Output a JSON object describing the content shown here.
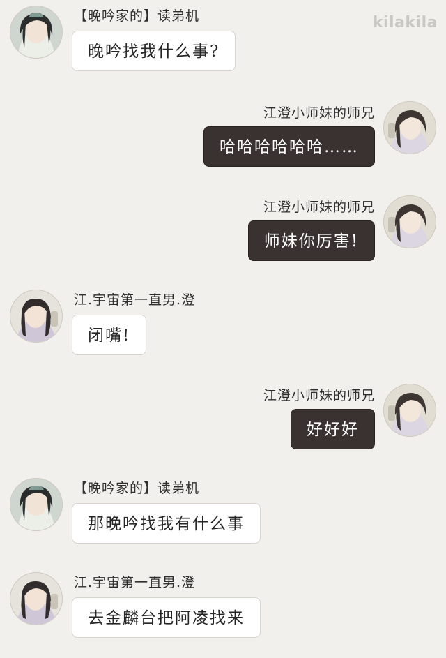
{
  "watermark": "kilakila",
  "messages": [
    {
      "side": "left",
      "avatar": "wanyin-avatar",
      "name": "【晚吟家的】读弟机",
      "text": "晚吟找我什么事?"
    },
    {
      "side": "right",
      "avatar": "senior-brother-avatar",
      "name": "江澄小师妹的师兄",
      "text": "哈哈哈哈哈哈……"
    },
    {
      "side": "right",
      "avatar": "senior-brother-avatar",
      "name": "江澄小师妹的师兄",
      "text": "师妹你厉害!"
    },
    {
      "side": "left",
      "avatar": "jiangcheng-avatar",
      "name": "江.宇宙第一直男.澄",
      "text": "闭嘴!"
    },
    {
      "side": "right",
      "avatar": "senior-brother-avatar",
      "name": "江澄小师妹的师兄",
      "text": "好好好"
    },
    {
      "side": "left",
      "avatar": "wanyin-avatar",
      "name": "【晚吟家的】读弟机",
      "text": "那晚吟找我有什么事"
    },
    {
      "side": "left",
      "avatar": "jiangcheng-avatar",
      "name": "江.宇宙第一直男.澄",
      "text": "去金麟台把阿凌找来"
    }
  ]
}
